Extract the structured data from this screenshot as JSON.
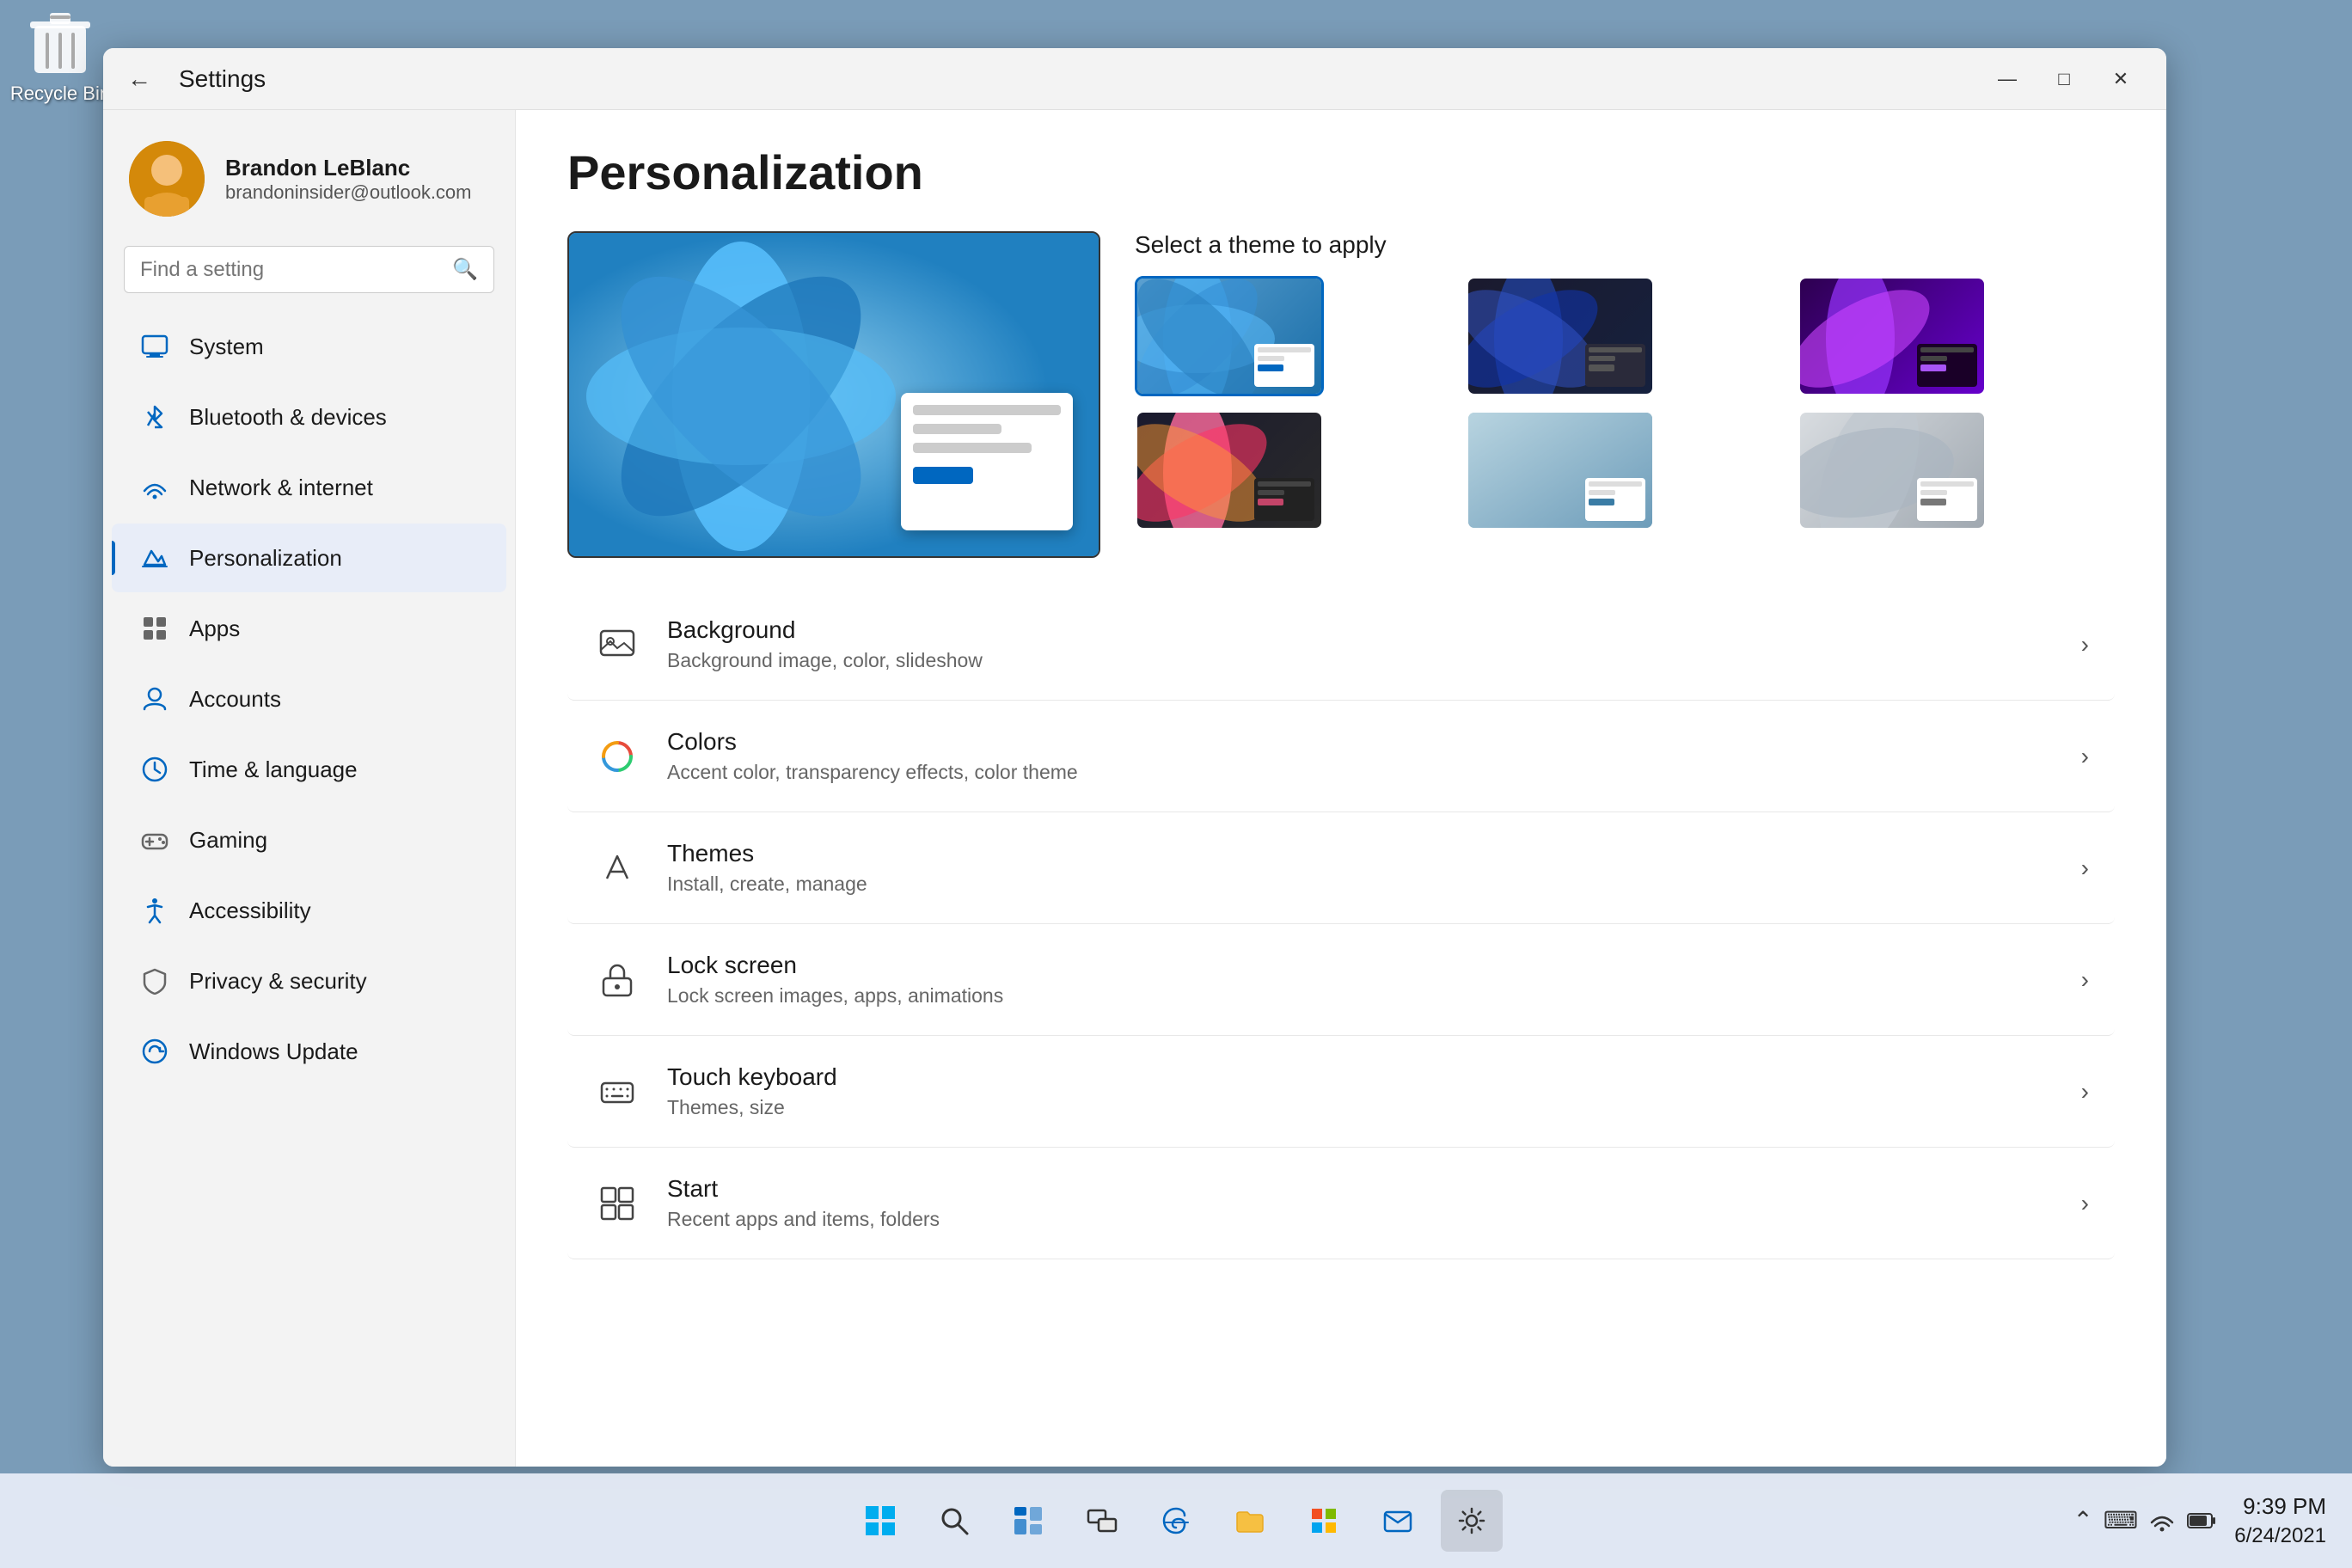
{
  "desktop": {
    "recycle_bin_label": "Recycle Bin"
  },
  "window": {
    "title": "Settings",
    "controls": {
      "minimize": "—",
      "maximize": "□",
      "close": "✕"
    }
  },
  "sidebar": {
    "user": {
      "name": "Brandon LeBlanc",
      "email": "brandoninsider@outlook.com"
    },
    "search_placeholder": "Find a setting",
    "nav_items": [
      {
        "id": "system",
        "label": "System",
        "color": "#0067c0"
      },
      {
        "id": "bluetooth",
        "label": "Bluetooth & devices",
        "color": "#0067c0"
      },
      {
        "id": "network",
        "label": "Network & internet",
        "color": "#0067c0"
      },
      {
        "id": "personalization",
        "label": "Personalization",
        "color": "#0067c0",
        "active": true
      },
      {
        "id": "apps",
        "label": "Apps",
        "color": "#555"
      },
      {
        "id": "accounts",
        "label": "Accounts",
        "color": "#0067c0"
      },
      {
        "id": "time",
        "label": "Time & language",
        "color": "#0067c0"
      },
      {
        "id": "gaming",
        "label": "Gaming",
        "color": "#555"
      },
      {
        "id": "accessibility",
        "label": "Accessibility",
        "color": "#0067c0"
      },
      {
        "id": "privacy",
        "label": "Privacy & security",
        "color": "#555"
      },
      {
        "id": "update",
        "label": "Windows Update",
        "color": "#0067c0"
      }
    ]
  },
  "main": {
    "page_title": "Personalization",
    "theme_section": {
      "select_label": "Select a theme to apply",
      "themes": [
        {
          "id": "windows-light",
          "selected": true,
          "bg": "linear-gradient(135deg,#5ba0d0,#1a6ea8)",
          "btn_color": "#0067c0"
        },
        {
          "id": "windows-dark",
          "selected": false,
          "bg": "linear-gradient(135deg,#1a1a2e,#16213e)",
          "btn_color": "#555"
        },
        {
          "id": "glow",
          "selected": false,
          "bg": "linear-gradient(135deg,#2d0050,#7b00a0)",
          "btn_color": "#a855f7"
        },
        {
          "id": "bloom",
          "selected": false,
          "bg": "linear-gradient(135deg,#ff6b9d,#c44569)",
          "btn_color": "#c44569"
        },
        {
          "id": "capture",
          "selected": false,
          "bg": "linear-gradient(135deg,#6db8c5,#3a7ca5)",
          "btn_color": "#3a7ca5"
        },
        {
          "id": "flow",
          "selected": false,
          "bg": "linear-gradient(135deg,#d0d8e0,#a0aab8)",
          "btn_color": "#777"
        }
      ]
    },
    "settings_items": [
      {
        "id": "background",
        "title": "Background",
        "desc": "Background image, color, slideshow",
        "icon": "🖼"
      },
      {
        "id": "colors",
        "title": "Colors",
        "desc": "Accent color, transparency effects, color theme",
        "icon": "🎨"
      },
      {
        "id": "themes",
        "title": "Themes",
        "desc": "Install, create, manage",
        "icon": "✏"
      },
      {
        "id": "lock-screen",
        "title": "Lock screen",
        "desc": "Lock screen images, apps, animations",
        "icon": "🖥"
      },
      {
        "id": "touch-keyboard",
        "title": "Touch keyboard",
        "desc": "Themes, size",
        "icon": "⌨"
      },
      {
        "id": "start",
        "title": "Start",
        "desc": "Recent apps and items, folders",
        "icon": "▦"
      }
    ]
  },
  "taskbar": {
    "time": "9:39 PM",
    "date": "6/24/2021",
    "icons": [
      {
        "id": "start",
        "symbol": "⊞"
      },
      {
        "id": "search",
        "symbol": "🔍"
      },
      {
        "id": "widgets",
        "symbol": "▦"
      },
      {
        "id": "multitask",
        "symbol": "⧉"
      },
      {
        "id": "edge",
        "symbol": "◉"
      },
      {
        "id": "explorer",
        "symbol": "📁"
      },
      {
        "id": "store",
        "symbol": "🛍"
      },
      {
        "id": "mail",
        "symbol": "✉"
      },
      {
        "id": "settings",
        "symbol": "⚙"
      }
    ]
  }
}
